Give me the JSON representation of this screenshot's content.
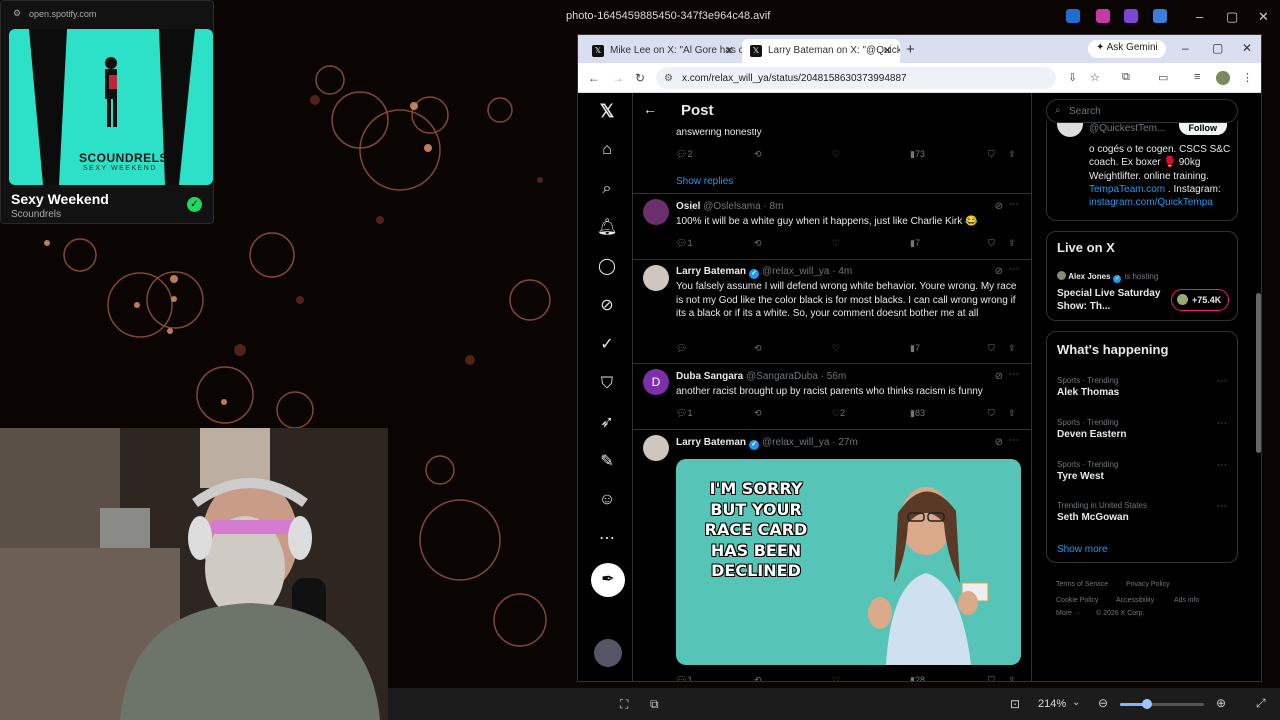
{
  "viewer": {
    "filename": "photo-1645459885450-347f3e964c48.avif",
    "zoom": "214%"
  },
  "spotify": {
    "url": "open.spotify.com",
    "album_band": "SCOUNDRELS",
    "album_title": "SEXY WEEKEND",
    "song": "Sexy Weekend",
    "artist": "Scoundrels"
  },
  "browser": {
    "tabs": [
      {
        "label": "Mike Lee on X: \"Al Gore has ca"
      },
      {
        "label": "Larry Bateman on X: \"@Quicke"
      }
    ],
    "ask_gemini": "Ask Gemini",
    "url": "x.com/relax_will_ya/status/2048158630373994887"
  },
  "x": {
    "header_title": "Post",
    "search_placeholder": "Search",
    "tweets": [
      {
        "text": "answering honestly",
        "replies": "2",
        "likes": "",
        "views": "73"
      },
      {
        "name": "Osiel",
        "handle": "@Oslelsama",
        "time": "8m",
        "text": "100% it will be a white guy when it happens, just like Charlie Kirk 😂",
        "replies": "1",
        "likes": "",
        "views": "7"
      },
      {
        "name": "Larry Bateman",
        "handle": "@relax_will_ya",
        "time": "4m",
        "text": "You falsely assume I will defend wrong white behavior. Youre wrong. My race is not my God like the color black is for most blacks. I can call wrong wrong if its a black or if its a white. So, your comment doesnt bother me at all",
        "replies": "",
        "likes": "",
        "views": "7"
      },
      {
        "name": "Duba Sangara",
        "handle": "@SangaraDuba",
        "time": "56m",
        "avatar_letter": "D",
        "text": "another racist brought up by racist parents who thinks racism is funny",
        "replies": "1",
        "likes": "2",
        "views": "83"
      },
      {
        "name": "Larry Bateman",
        "handle": "@relax_will_ya",
        "time": "27m",
        "meme_caption": "I'M SORRY BUT YOUR RACE CARD HAS BEEN DECLINED",
        "replies": "1",
        "views": "28"
      }
    ],
    "show_replies": "Show replies",
    "profile_card": {
      "handle": "@QuickestTem...",
      "follow": "Follow",
      "bio": "o cogés o te cogen. CSCS S&C coach. Ex boxer 🥊 90kg Weightlifter. online training.",
      "link1": "TempaTeam.com",
      "mid": " . Instagram:",
      "link2": "instagram.com/QuickTempa"
    },
    "live": {
      "title": "Live on X",
      "host": "Alex Jones",
      "is_hosting": "is hosting",
      "show": "Special Live Saturday Show: Th...",
      "count": "+75.4K"
    },
    "happening": {
      "title": "What's happening",
      "trends": [
        {
          "category": "Sports · Trending",
          "name": "Alek Thomas"
        },
        {
          "category": "Sports · Trending",
          "name": "Deven Eastern"
        },
        {
          "category": "Sports · Trending",
          "name": "Tyre West"
        },
        {
          "category": "Trending in United States",
          "name": "Seth McGowan"
        }
      ],
      "show_more": "Show more"
    },
    "footer": {
      "terms": "Terms of Service",
      "privacy": "Privacy Policy",
      "cookie": "Cookie Policy",
      "access": "Accessibility",
      "ads": "Ads info",
      "more": "More ···",
      "copy": "© 2026 X Corp."
    }
  }
}
